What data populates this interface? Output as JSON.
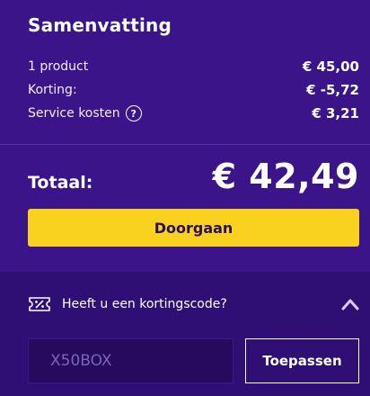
{
  "summary": {
    "title": "Samenvatting",
    "rows": [
      {
        "label": "1 product",
        "value": "€ 45,00"
      },
      {
        "label": "Korting:",
        "value": "€ -5,72"
      },
      {
        "label": "Service kosten",
        "value": "€ 3,21",
        "info_icon": "help-circle-icon"
      }
    ],
    "total_label": "Totaal:",
    "total_value": "€ 42,49",
    "continue_label": "Doorgaan"
  },
  "coupon": {
    "icon": "discount-ticket-icon",
    "question": "Heeft u een kortingscode?",
    "toggle_icon": "chevron-up-icon",
    "input_value": "X50BOX",
    "apply_label": "Toepassen"
  },
  "colors": {
    "background": "#3a1488",
    "coupon_background": "#2f0f73",
    "accent_button": "#f8d21f",
    "button_text": "#2a0f63"
  }
}
